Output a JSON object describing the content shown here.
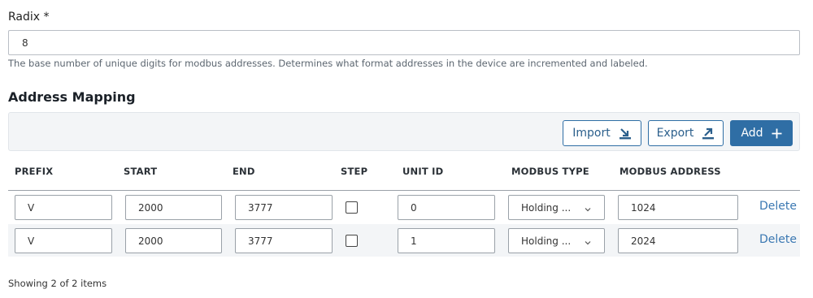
{
  "radix": {
    "label": "Radix *",
    "value": "8",
    "help": "The base number of unique digits for modbus addresses. Determines what format addresses in the device are incremented and labeled."
  },
  "mapping": {
    "title": "Address Mapping",
    "buttons": {
      "import": "Import",
      "export": "Export",
      "add": "Add"
    },
    "columns": {
      "prefix": "PREFIX",
      "start": "START",
      "end": "END",
      "step": "STEP",
      "unit_id": "UNIT ID",
      "modbus_type": "MODBUS TYPE",
      "modbus_address": "MODBUS ADDRESS"
    },
    "rows": [
      {
        "prefix": "V",
        "start": "2000",
        "end": "3777",
        "step": false,
        "unit_id": "0",
        "modbus_type": "Holding ...",
        "modbus_address": "1024",
        "delete": "Delete"
      },
      {
        "prefix": "V",
        "start": "2000",
        "end": "3777",
        "step": false,
        "unit_id": "1",
        "modbus_type": "Holding ...",
        "modbus_address": "2024",
        "delete": "Delete"
      }
    ],
    "footer": "Showing 2 of 2 items"
  },
  "colors": {
    "accent": "#2f6ea5",
    "link": "#3b78b2",
    "toolbar_bg": "#f3f5f7"
  }
}
